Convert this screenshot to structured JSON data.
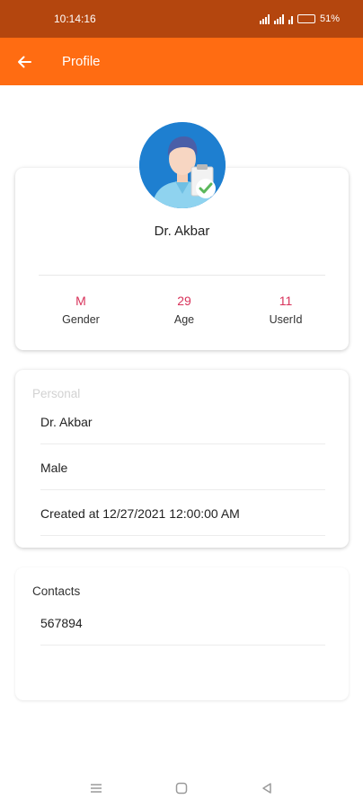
{
  "status": {
    "time": "10:14:16",
    "battery": "51%"
  },
  "appbar": {
    "title": "Profile"
  },
  "profile": {
    "name": "Dr. Akbar",
    "stats": [
      {
        "value": "M",
        "label": "Gender"
      },
      {
        "value": "29",
        "label": "Age"
      },
      {
        "value": "11",
        "label": "UserId"
      }
    ]
  },
  "personal": {
    "title": "Personal",
    "rows": [
      "Dr. Akbar",
      "Male",
      "Created at 12/27/2021 12:00:00 AM"
    ]
  },
  "contacts": {
    "title": "Contacts",
    "rows": [
      "567894"
    ]
  },
  "colors": {
    "statusbar": "#b4460e",
    "appbar": "#ff6c12",
    "stat_value": "#d8335b"
  }
}
